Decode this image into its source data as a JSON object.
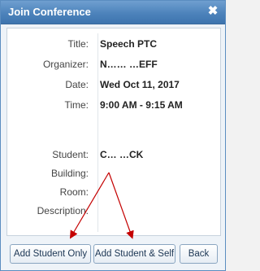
{
  "dialog": {
    "title": "Join Conference",
    "close_glyph": "✖"
  },
  "fields": [
    {
      "label": "Title:",
      "value": "Speech PTC"
    },
    {
      "label": "Organizer:",
      "value": "N…… …EFF"
    },
    {
      "label": "Date:",
      "value": "Wed Oct 11, 2017"
    },
    {
      "label": "Time:",
      "value": "9:00 AM - 9:15 AM"
    },
    {
      "label": "Student:",
      "value": "C… …CK"
    },
    {
      "label": "Building:",
      "value": ""
    },
    {
      "label": "Room:",
      "value": ""
    },
    {
      "label": "Description:",
      "value": ""
    }
  ],
  "buttons": {
    "add_student_only": "Add Student Only",
    "add_student_self": "Add Student & Self",
    "back": "Back"
  },
  "colors": {
    "titlebar": "#4d83bb",
    "annotation_arrow": "#c40000"
  }
}
